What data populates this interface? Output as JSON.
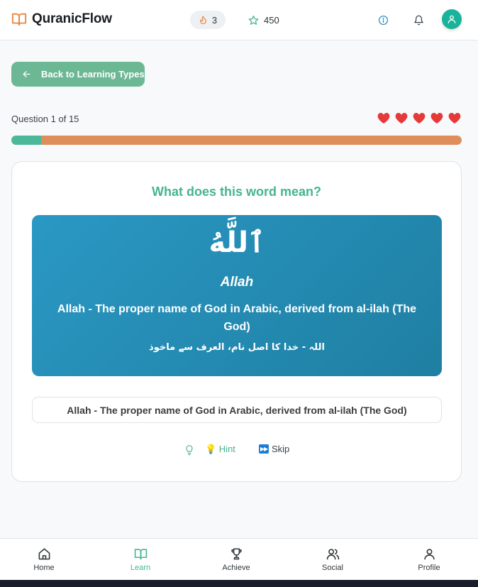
{
  "header": {
    "app_name": "QuranicFlow",
    "streak_count": "3",
    "points": "450",
    "icons": [
      "book-open-icon",
      "flame-icon",
      "star-icon",
      "info-icon",
      "bell-icon",
      "user-icon"
    ]
  },
  "back_button": {
    "label": "Back to Learning Types"
  },
  "quiz": {
    "question_counter": "Question 1 of 15",
    "hearts_remaining": 5,
    "progress_fraction": 0.0667
  },
  "card": {
    "prompt": "What does this word mean?",
    "arabic_word": "ٱللَّهُ",
    "transliteration": "Allah",
    "meaning_en": "Allah - The proper name of God in Arabic, derived from al-ilah (The God)",
    "meaning_ur": "اللہ - خدا کا اصل نام، العرف سے ماخوذ",
    "answer_option": "Allah - The proper name of God in Arabic, derived from al-ilah (The God)"
  },
  "actions": {
    "hint_label": "💡 Hint",
    "skip_label": "Skip"
  },
  "bottom_nav": {
    "home": "Home",
    "learn": "Learn",
    "achieve": "Achieve",
    "social": "Social",
    "profile": "Profile",
    "active": "learn"
  },
  "colors": {
    "primary": "#45b58e",
    "back_button": "#6cb894",
    "progress_fill": "#4bb89a",
    "progress_track": "#de8e5a",
    "heart": "#e63a3a",
    "word_box_start": "#2a98c4",
    "word_box_end": "#1f7fa2",
    "avatar": "#19b39a"
  }
}
